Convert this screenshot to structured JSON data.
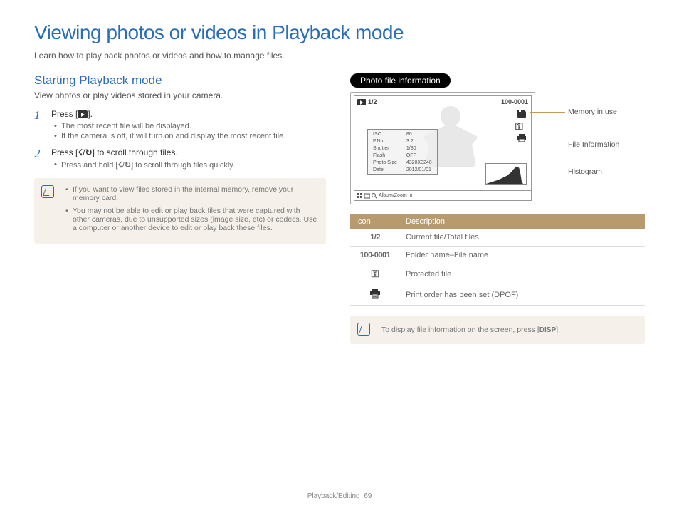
{
  "page": {
    "title": "Viewing photos or videos in Playback mode",
    "intro": "Learn how to play back photos or videos and how to manage files."
  },
  "left": {
    "section_title": "Starting Playback mode",
    "section_intro": "View photos or play videos stored in your camera.",
    "step1": {
      "num": "1",
      "text_a": "Press [",
      "text_b": "].",
      "bul1": "The most recent file will be displayed.",
      "bul2": "If the camera is off, it will turn on and display the most recent file."
    },
    "step2": {
      "num": "2",
      "text_a": "Press [",
      "flash": "☇",
      "slash": "/",
      "timer": "↻",
      "text_b": "] to scroll through files.",
      "bul1_a": "Press and hold [",
      "bul1_b": "] to scroll through files quickly."
    },
    "note": {
      "li1": "If you want to view files stored in the internal memory, remove your memory card.",
      "li2": "You may not be able to edit or play back files that were captured with other cameras, due to unsupported sizes (image size, etc) or codecs. Use a computer or another device to edit or play back these files."
    }
  },
  "right": {
    "pill": "Photo file information",
    "screen": {
      "tb_count": "1/2",
      "tb_file": "100-0001",
      "info": {
        "r1a": "ISO",
        "r1b": "80",
        "r2a": "F.No",
        "r2b": "3.2",
        "r3a": "Shutter",
        "r3b": "1/30",
        "r4a": "Flash",
        "r4b": "OFF",
        "r5a": "Photo Size",
        "r5b": "4320X3240",
        "r6a": "Date",
        "r6b": "2012/01/01"
      },
      "bottom": "Album/Zoom In"
    },
    "callouts": {
      "mem": "Memory in use",
      "fileinfo": "File Information",
      "histo": "Histogram"
    },
    "table": {
      "h1": "Icon",
      "h2": "Description",
      "r1_icon": "1/2",
      "r1_desc": "Current file/Total files",
      "r2_icon": "100-0001",
      "r2_desc": "Folder name–File name",
      "r3_desc": "Protected file",
      "r4_desc": "Print order has been set (DPOF)"
    },
    "note2_a": "To display file information on the screen, press [",
    "note2_disp": "DISP",
    "note2_b": "]."
  },
  "footer": {
    "section": "Playback/Editing",
    "page": "69"
  }
}
